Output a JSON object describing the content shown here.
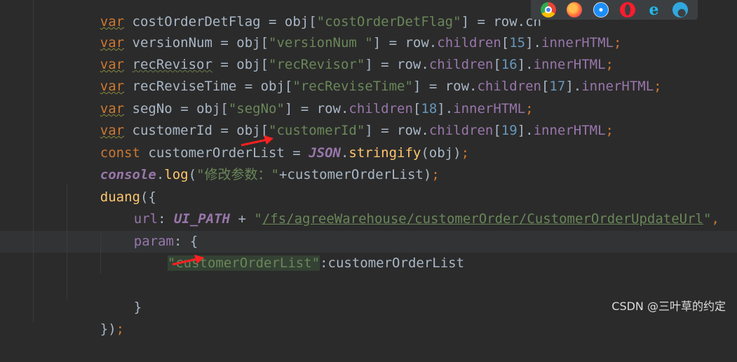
{
  "browser_icons": [
    {
      "name": "chrome-icon",
      "color": "#e8b51a"
    },
    {
      "name": "firefox-icon",
      "color": "#ff7139"
    },
    {
      "name": "safari-icon",
      "color": "#1c8ef9"
    },
    {
      "name": "opera-icon",
      "color": "#ff1b2d"
    },
    {
      "name": "ie-icon",
      "color": "#1ebbee"
    },
    {
      "name": "edge-icon",
      "color": "#2fa8e0"
    }
  ],
  "code": {
    "l0": {
      "kw": "var",
      "name": "costOrderDetFlag",
      "eq": " = obj[",
      "key": "\"costOrderDetFlag\"",
      "rest": "] = row.ch"
    },
    "l1": {
      "kw": "var",
      "name": "versionNum",
      "eq": " = obj[",
      "key": "\"versionNum \"",
      "mid": "] = row.",
      "member": "children",
      "idx_open": "[",
      "idx": "15",
      "idx_close": "].",
      "prop": "innerHTML",
      "semi": ";"
    },
    "l2": {
      "kw": "var",
      "name": "recRevisor",
      "eq": " = obj[",
      "key": "\"recRevisor\"",
      "mid": "] = row.",
      "member": "children",
      "idx_open": "[",
      "idx": "16",
      "idx_close": "].",
      "prop": "innerHTML",
      "semi": ";"
    },
    "l3": {
      "kw": "var",
      "name": "recReviseTime",
      "eq": " = obj[",
      "key": "\"recReviseTime\"",
      "mid": "] = row.",
      "member": "children",
      "idx_open": "[",
      "idx": "17",
      "idx_close": "].",
      "prop": "innerHTML",
      "semi": ";"
    },
    "l4": {
      "kw": "var",
      "name": "segNo",
      "eq": " = obj[",
      "key": "\"segNo\"",
      "mid": "] = row.",
      "member": "children",
      "idx_open": "[",
      "idx": "18",
      "idx_close": "].",
      "prop": "innerHTML",
      "semi": ";"
    },
    "l5": {
      "kw": "var",
      "name": "customerId",
      "eq": " = obj[",
      "key": "\"customerId\"",
      "mid": "] = row.",
      "member": "children",
      "idx_open": "[",
      "idx": "19",
      "idx_close": "].",
      "prop": "innerHTML",
      "semi": ";"
    },
    "l6": {
      "kw": "const",
      "name": " customerOrderList = ",
      "json": "JSON",
      "dot": ".",
      "fn": "stringify",
      "args": "(obj)",
      "semi": ";"
    },
    "l7": {
      "obj": "console",
      "dot": ".",
      "fn": "log",
      "open": "(",
      "str": "\"修改参数：\"",
      "rest": "+customerOrderList)",
      "semi": ";"
    },
    "l8": {
      "fn": "duang",
      "rest": "({"
    },
    "l9": {
      "key": "url",
      "colon": ": ",
      "const": "UI_PATH",
      "plus": " + ",
      "q1": "\"",
      "url": "/fs/agreeWarehouse/customerOrder/CustomerOrderUpdateUrl",
      "q2": "\"",
      "comma": ","
    },
    "l10": {
      "key": "param",
      "rest": ": {"
    },
    "l11": {
      "str": "\"customerOrderList\"",
      "rest": ":customerOrderList"
    },
    "l13": {
      "text": "}"
    },
    "l14": {
      "text": "})",
      "semi": ";"
    }
  },
  "watermark": "CSDN @三叶草的约定"
}
